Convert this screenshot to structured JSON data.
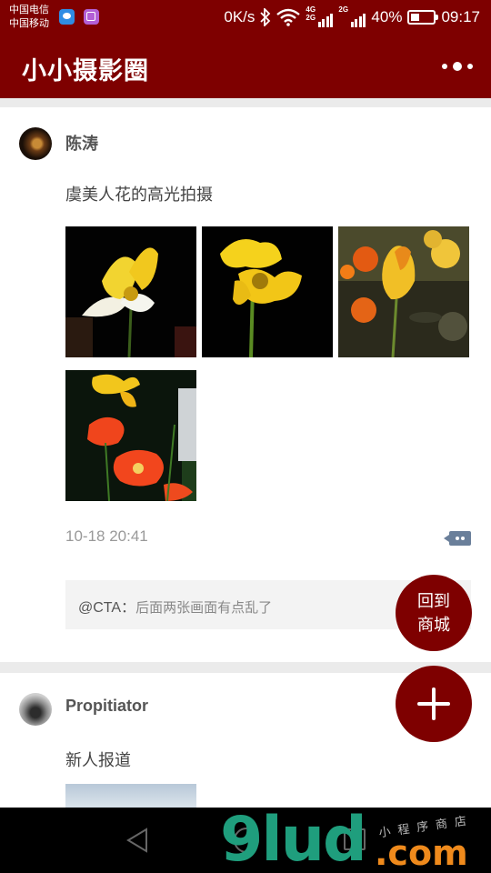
{
  "status_bar": {
    "carrier_1": "中国电信",
    "carrier_2": "中国移动",
    "net_speed": "0K/s",
    "net_1": "4G\n2G",
    "net_2": "2G",
    "battery": "40%",
    "battery_level": 0.4,
    "time": "09:17",
    "icons": [
      "message-notification-icon",
      "gallery-notification-icon",
      "bluetooth-icon",
      "wifi-icon",
      "signal-icon",
      "battery-icon"
    ]
  },
  "app_bar": {
    "title": "小小摄影圈",
    "more_icon": "more-dots-icon"
  },
  "posts": [
    {
      "username": "陈涛",
      "content": "虞美人花的高光拍摄",
      "timestamp": "10-18 20:41",
      "comments": [
        {
          "author": "@CTA：",
          "text": "后面两张画面有点乱了"
        }
      ]
    },
    {
      "username": "Propitiator",
      "content": "新人报道"
    }
  ],
  "fab": {
    "home_line1": "回到",
    "home_line2": "商城",
    "add_icon": "plus-icon"
  },
  "watermark": {
    "main": "9lud",
    "small": "小程序商店",
    "domain": ".com"
  },
  "colors": {
    "primary": "#7e0000",
    "background": "#ebebeb",
    "comment_bg": "#f3f3f3"
  }
}
